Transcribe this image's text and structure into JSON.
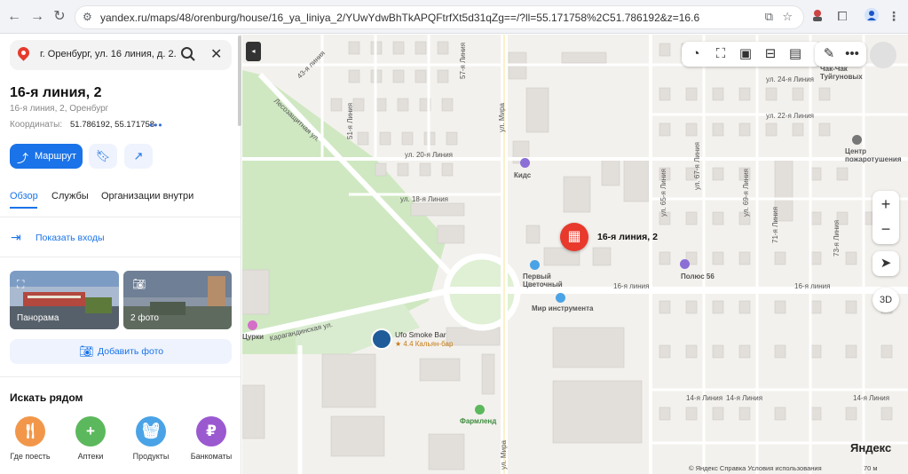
{
  "browser": {
    "url": "yandex.ru/maps/48/orenburg/house/16_ya_liniya_2/YUwYdwBhTkAPQFtrfXt5d31qZg==/?ll=55.171758%2C51.786192&z=16.6"
  },
  "sidebar": {
    "search_value": "г. Оренбург, ул. 16 линия, д. 2.",
    "title": "16-я линия, 2",
    "address": "16-я линия, 2, Оренбург",
    "coords_label": "Координаты:",
    "coords_value": "51.786192, 55.171758",
    "route_label": "Маршрут",
    "tabs": [
      "Обзор",
      "Службы",
      "Организации внутри"
    ],
    "show_entrances": "Показать входы",
    "photos": [
      {
        "label": "Панорама"
      },
      {
        "label": "2 фото"
      }
    ],
    "add_photo": "Добавить фото",
    "nearby_title": "Искать рядом",
    "nearby": [
      {
        "label": "Где поесть",
        "color": "#f2974a"
      },
      {
        "label": "Аптеки",
        "color": "#5cb85c"
      },
      {
        "label": "Продукты",
        "color": "#4aa3e6"
      },
      {
        "label": "Банкоматы",
        "color": "#9b59d0"
      }
    ]
  },
  "map": {
    "marker_label": "16-я линия, 2",
    "streets": {
      "mira": "ул. Мира",
      "liniya16a": "16-я линия",
      "liniya16b": "16-я линия",
      "karagandinskaya": "Карагандинская ул.",
      "lesozashchitnaya": "Лесозащитная ул.",
      "l20": "ул. 20-я Линия",
      "l18": "ул. 18-я Линия",
      "l24": "ул. 24-я Линия",
      "l22": "ул. 22-я Линия",
      "l67": "ул. 67-я Линия",
      "l69": "ул. 69-я Линия",
      "l71": "71-я Линия",
      "l57": "57-я Линия",
      "l51": "51-я Линия",
      "l43": "43-я линия",
      "l73": "73-я Линия",
      "l65": "ул. 65-я Линия",
      "l14a": "14-я Линия",
      "l14b": "14-я Линия",
      "l14c": "14-я Линия"
    },
    "pois": {
      "kids": "Кидс",
      "tsvetochny": "Первый Цветочный",
      "mir": "Мир инструмента",
      "polyus": "Полюс 56",
      "tsurki": "Цурки",
      "ufo_name": "Ufo Smoke Bar",
      "ufo_rating": "★ 4.4 Кальян-бар",
      "farmlend": "Фармленд",
      "chak": "Чак-Чак Туйгуновых",
      "fire": "Центр пожаротушения"
    },
    "btn_3d": "3D",
    "zoom_in": "+",
    "zoom_out": "−",
    "logo": "Яндекс",
    "copyright": "© Яндекс  Справка  Условия использования",
    "scale": "70 м"
  }
}
